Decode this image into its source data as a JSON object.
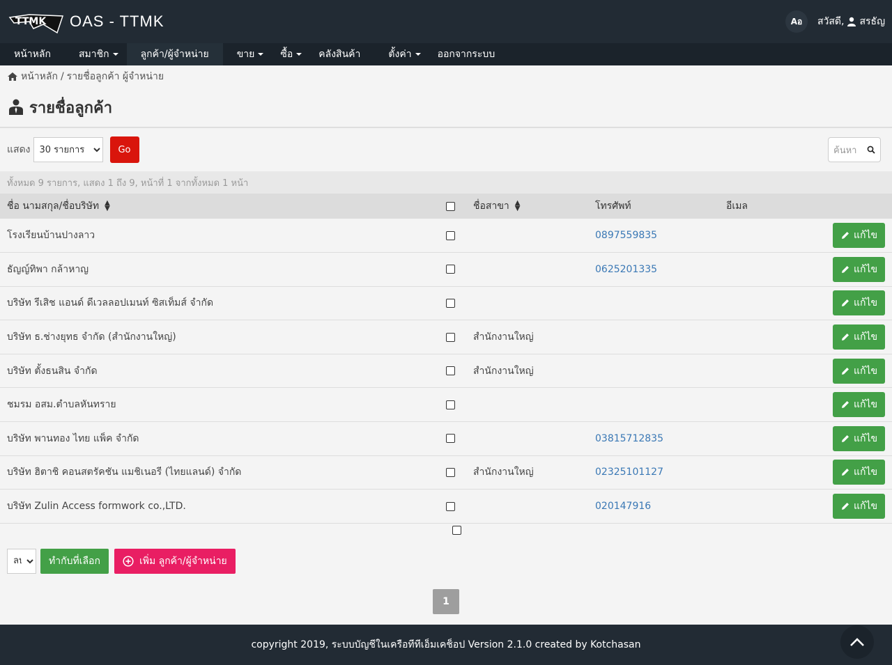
{
  "header": {
    "app_title": "OAS - TTMK",
    "logo_text": "TTMK",
    "language_label": "Aอ",
    "greeting": "สวัสดี,",
    "user_name": "สรธัญ"
  },
  "nav": {
    "items": [
      {
        "label": "หน้าหลัก",
        "dropdown": false
      },
      {
        "label": "สมาชิก",
        "dropdown": true
      },
      {
        "label": "ลูกค้า/ผู้จำหน่าย",
        "dropdown": false
      },
      {
        "label": "ขาย",
        "dropdown": true
      },
      {
        "label": "ซื้อ",
        "dropdown": true
      },
      {
        "label": "คลังสินค้า",
        "dropdown": false
      },
      {
        "label": "ตั้งค่า",
        "dropdown": true
      },
      {
        "label": "ออกจากระบบ",
        "dropdown": false
      }
    ]
  },
  "breadcrumb": {
    "home": "หน้าหลัก",
    "separator": "/",
    "current": "รายชื่อลูกค้า ผู้จำหน่าย"
  },
  "page": {
    "title": "รายชื่อลูกค้า"
  },
  "toolbar": {
    "show_label": "แสดง",
    "per_page_selected": "30 รายการ",
    "go_label": "Go",
    "search_placeholder": "ค้นหา"
  },
  "summary": "ทั้งหมด 9 รายการ, แสดง 1 ถึง 9, หน้าที่ 1 จากทั้งหมด 1 หน้า",
  "table": {
    "columns": {
      "name": "ชื่อ นามสกุล/ชื่อบริษัท",
      "branch": "ชื่อสาขา",
      "phone": "โทรศัพท์",
      "email": "อีเมล"
    },
    "edit_label": "แก้ไข",
    "rows": [
      {
        "name": "โรงเรียนบ้านปางลาว",
        "branch": "",
        "phone": "0897559835",
        "email": ""
      },
      {
        "name": "ธัญญ์ทิพา กล้าหาญ",
        "branch": "",
        "phone": "0625201335",
        "email": ""
      },
      {
        "name": "บริษัท รีเสิช แอนด์ ดีเวลลอปเมนท์ ซิสเท็มส์ จำกัด",
        "branch": "",
        "phone": "",
        "email": ""
      },
      {
        "name": "บริษัท ธ.ช่างยุทธ จำกัด (สำนักงานใหญ่)",
        "branch": "สำนักงานใหญ่",
        "phone": "",
        "email": ""
      },
      {
        "name": "บริษัท ตั้งธนสิน จำกัด",
        "branch": "สำนักงานใหญ่",
        "phone": "",
        "email": ""
      },
      {
        "name": "ชมรม อสม.ตำบลหันทราย",
        "branch": "",
        "phone": "",
        "email": ""
      },
      {
        "name": "บริษัท พานทอง ไทย แพ็ค จำกัด",
        "branch": "",
        "phone": "03815712835",
        "email": ""
      },
      {
        "name": "บริษัท ฮิตาชิ คอนสตรัคชัน แมชิเนอรี (ไทยแลนด์) จำกัด",
        "branch": "สำนักงานใหญ่",
        "phone": "02325101127",
        "email": ""
      },
      {
        "name": "บริษัท Zulin Access formwork co.,LTD.",
        "branch": "",
        "phone": "020147916",
        "email": ""
      }
    ]
  },
  "bulk": {
    "action_selected": "ลบ",
    "apply_label": "ทำกับที่เลือก",
    "add_label": "เพิ่ม ลูกค้า/ผู้จำหน่าย"
  },
  "pagination": {
    "current_page": "1"
  },
  "footer": {
    "text": "copyright 2019, ระบบบัญชีในเครือทีทีเอ็มเคช็อป Version 2.1.0 created by Kotchasan"
  },
  "colors": {
    "topbar": "#222b34",
    "navbar": "#1b232b",
    "go_button": "#d9150c",
    "edit_button": "#43a047",
    "add_button": "#e91e63",
    "link": "#3a78b5"
  },
  "icons": [
    "logo-icon",
    "translate-icon",
    "user-icon",
    "home-icon",
    "customer-icon",
    "search-icon",
    "sort-icon",
    "pencil-icon",
    "plus-circle-icon",
    "chevron-up-icon"
  ]
}
